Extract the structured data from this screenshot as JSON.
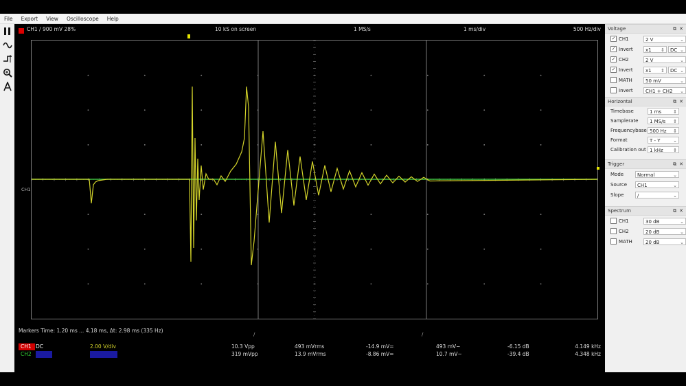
{
  "menu": [
    "File",
    "Export",
    "View",
    "Oscilloscope",
    "Help"
  ],
  "toolbar": [
    {
      "icon": "pause-icon",
      "glyph": "❚❚"
    },
    {
      "icon": "waveform-icon",
      "glyph": "∿"
    },
    {
      "icon": "trigger-icon",
      "glyph": "⊣"
    },
    {
      "icon": "zoom-icon",
      "glyph": "⊕"
    },
    {
      "icon": "measure-icon",
      "glyph": "A"
    }
  ],
  "scope": {
    "channel_info": "CH1  /  900 mV  28%",
    "samples": "10 kS on screen",
    "samplerate": "1 MS/s",
    "timebase": "1 ms/div",
    "freqbase": "500 Hz/div",
    "ch_marker": "CH1",
    "markers_text": "Markers  Time: 1.20 ms ... 4.18 ms,  Δt: 2.98 ms (335 Hz)",
    "measure_rows": [
      {
        "ch": "CH1",
        "mode": "DC",
        "vdiv": "2.00 V/div",
        "vpp": "10.3 Vpp",
        "vrms": "493 mVrms",
        "dc": "-14.9 mV=",
        "ac": "493 mV~",
        "db": "-6.15 dB",
        "freq": "4.149 kHz",
        "color": "#ffffff",
        "chip": "#d00000"
      },
      {
        "ch": "CH2",
        "mode": "",
        "vdiv": "",
        "vpp": "319 mVpp",
        "vrms": "13.9 mVrms",
        "dc": "-8.86 mV=",
        "ac": "10.7 mV~",
        "db": "-39.4 dB",
        "freq": "4.348 kHz",
        "color": "#33cc33",
        "chip": "#1a1aa0"
      }
    ]
  },
  "colors": {
    "ch1": "#d4d42a",
    "ch2": "#3fbf3f",
    "grid": "#8a8a8a",
    "vdiv": "#d4d42a"
  },
  "voltage": {
    "title": "Voltage",
    "rows": [
      {
        "check": true,
        "label": "CH1",
        "value": "2 V",
        "extra": ""
      },
      {
        "check": true,
        "label": "Invert",
        "value": "x1",
        "extra": "DC"
      },
      {
        "check": true,
        "label": "CH2",
        "value": "2 V",
        "extra": ""
      },
      {
        "check": true,
        "label": "Invert",
        "value": "x1",
        "extra": "DC"
      },
      {
        "check": false,
        "label": "MATH",
        "value": "50 mV",
        "extra": ""
      },
      {
        "check": false,
        "label": "Invert",
        "value": "CH1 + CH2",
        "extra": ""
      }
    ]
  },
  "horizontal": {
    "title": "Horizontal",
    "rows": [
      {
        "label": "Timebase",
        "value": "1 ms"
      },
      {
        "label": "Samplerate",
        "value": "1 MS/s"
      },
      {
        "label": "Frequencybase",
        "value": "500 Hz"
      },
      {
        "label": "Format",
        "value": "T - Y"
      },
      {
        "label": "Calibration out",
        "value": "1 kHz"
      }
    ]
  },
  "trigger": {
    "title": "Trigger",
    "rows": [
      {
        "label": "Mode",
        "value": "Normal"
      },
      {
        "label": "Source",
        "value": "CH1"
      },
      {
        "label": "Slope",
        "value": "/"
      }
    ]
  },
  "spectrum": {
    "title": "Spectrum",
    "rows": [
      {
        "check": false,
        "label": "CH1",
        "value": "30 dB"
      },
      {
        "check": false,
        "label": "CH2",
        "value": "20 dB"
      },
      {
        "check": false,
        "label": "MATH",
        "value": "20 dB"
      }
    ]
  }
}
